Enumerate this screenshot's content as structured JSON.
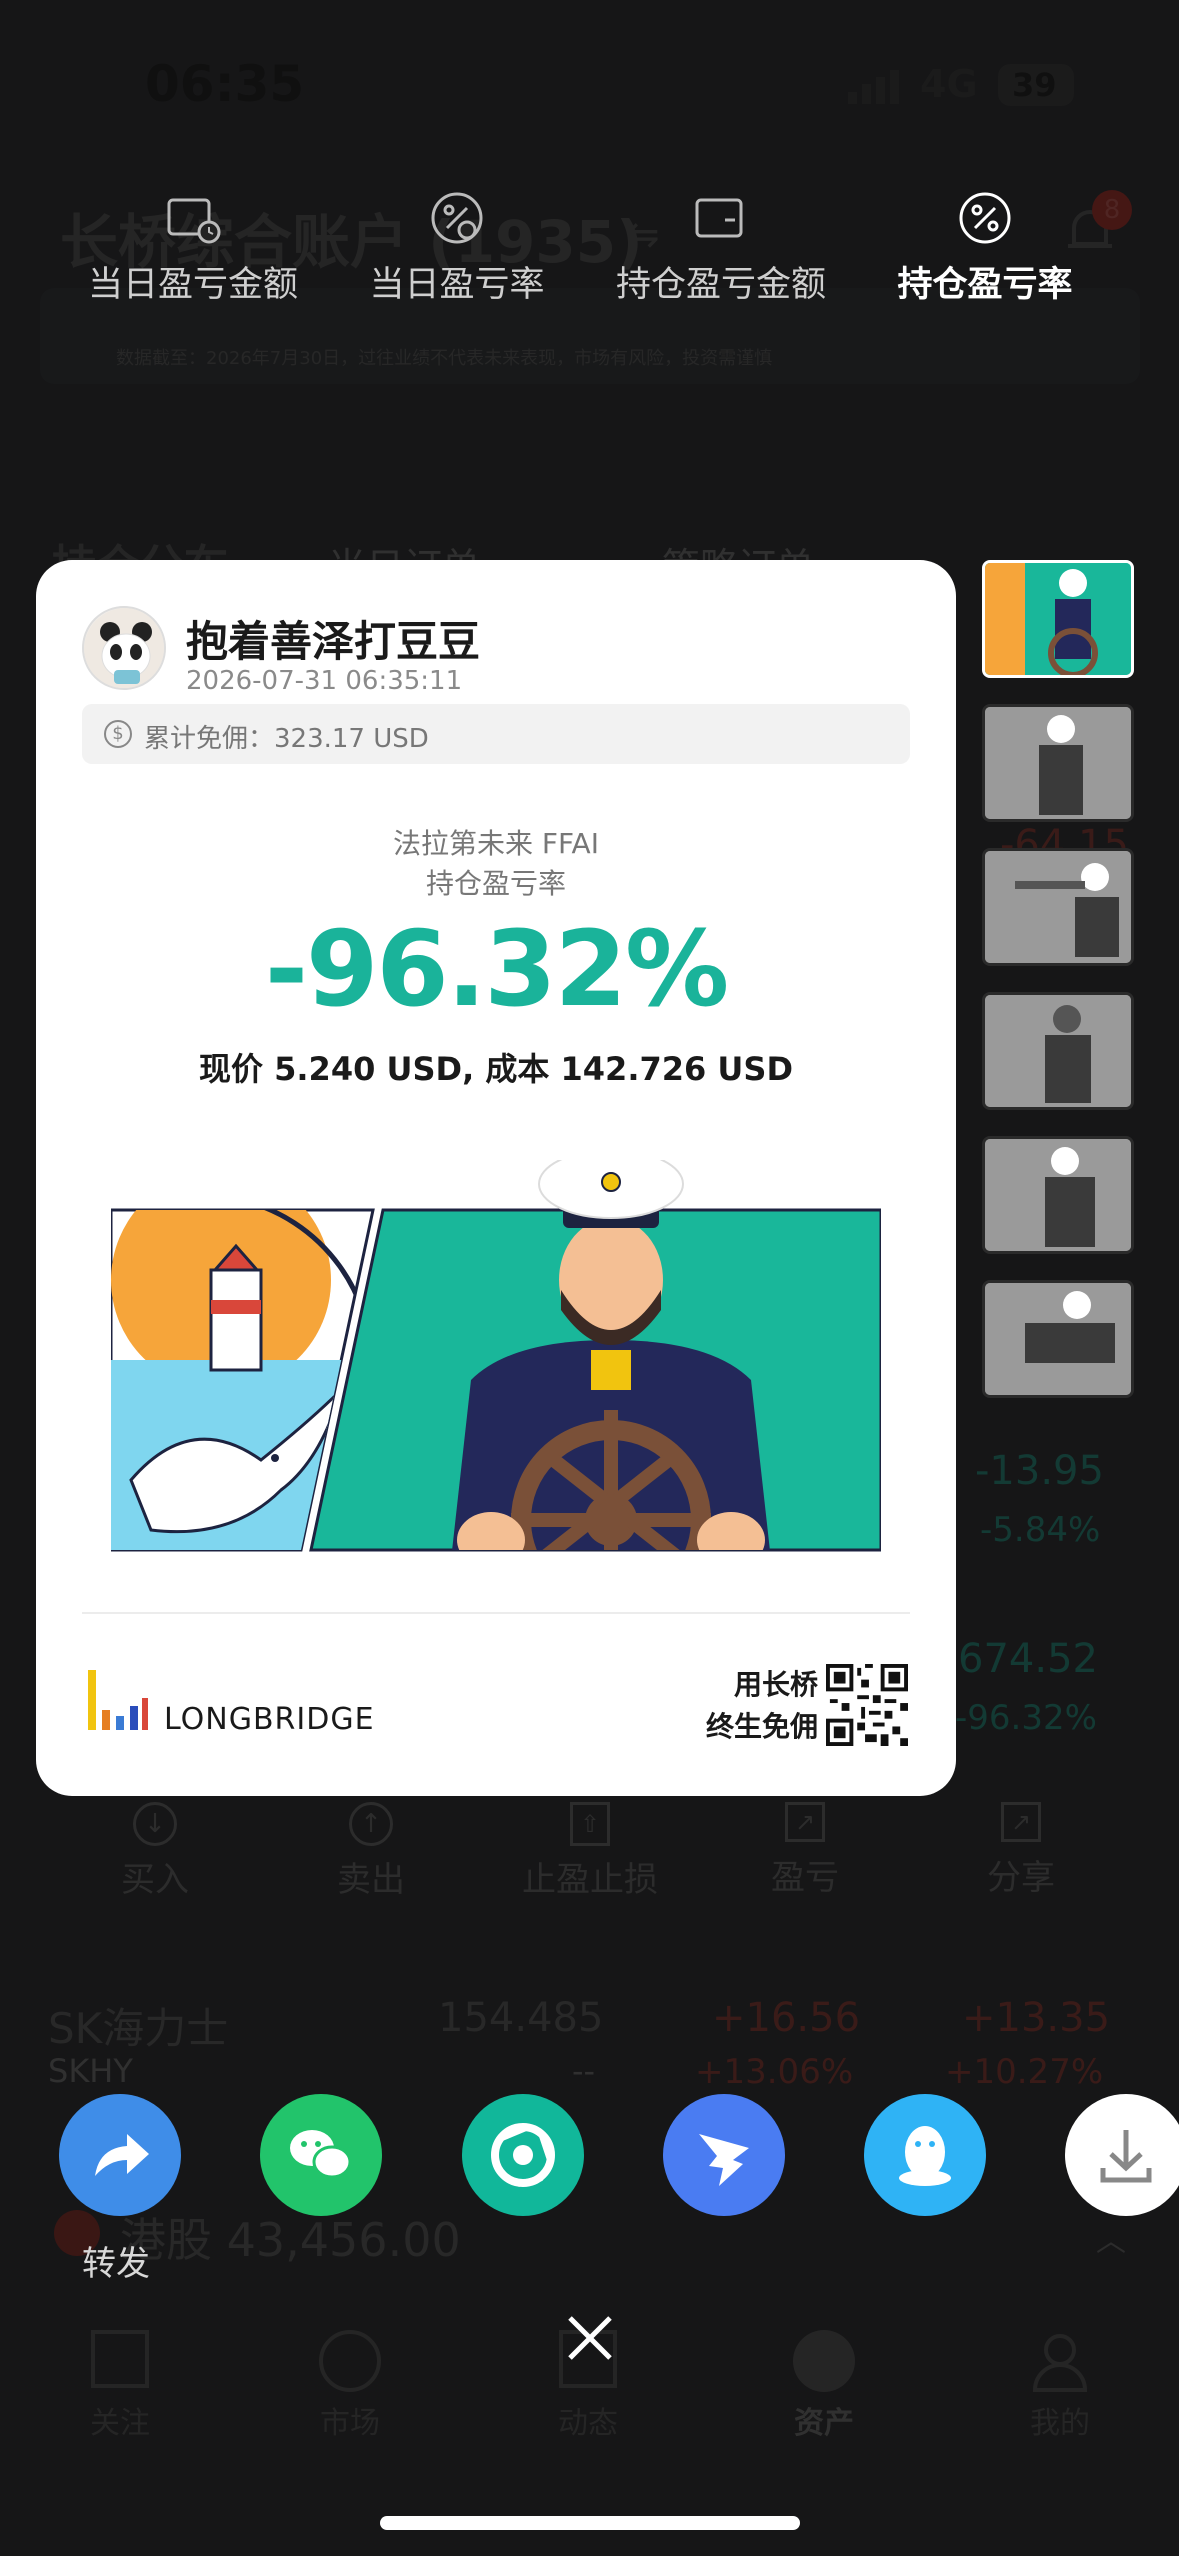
{
  "status_bar": {
    "time": "06:35",
    "network": "4G",
    "battery": "39"
  },
  "background": {
    "account_title": "长桥综合账户 (1935)",
    "banner_notice": "数据截至：2026年7月30日，过往业绩不代表未来表现，市场有风险，投资需谨慎",
    "section_tabs": [
      "持仓分布",
      "当日订单",
      "策略订单"
    ],
    "right_values": [
      "-64.15",
      "-13.95",
      "-5.84%",
      "674.52",
      "-96.32%"
    ],
    "action_bar": [
      "买入",
      "卖出",
      "止盈止损",
      "盈亏",
      "分享"
    ],
    "row_sk": {
      "name": "SK海力士",
      "ticker": "SKHY",
      "price": "154.485",
      "dash": "--",
      "change": "+16.56",
      "change_pct": "+13.06%",
      "pnl": "+13.35",
      "pnl_pct": "+10.27%"
    },
    "hk_section": "港股 43,456.00",
    "bottom_nav": [
      "关注",
      "市场",
      "动态",
      "资产",
      "我的"
    ],
    "notification_count": "8"
  },
  "metric_tabs": [
    {
      "label": "当日盈亏金额",
      "icon": "wallet-clock-icon",
      "active": false
    },
    {
      "label": "当日盈亏率",
      "icon": "percent-clock-icon",
      "active": false
    },
    {
      "label": "持仓盈亏金额",
      "icon": "wallet-icon",
      "active": false
    },
    {
      "label": "持仓盈亏率",
      "icon": "percent-icon",
      "active": true
    }
  ],
  "card": {
    "username": "抱着善泽打豆豆",
    "timestamp": "2026-07-31 06:35:11",
    "fee_label": "累计免佣：323.17 USD",
    "stock": "法拉第未来 FFAI",
    "metric": "持仓盈亏率",
    "value": "-96.32%",
    "value_color": "#1ab39a",
    "price_line": "现价 5.240 USD,  成本 142.726 USD",
    "brand": "LONGBRIDGE",
    "promo_line1": "用长桥",
    "promo_line2": "终生免佣"
  },
  "share": {
    "buttons": [
      {
        "name": "forward",
        "color": "#3f8de8",
        "icon": "forward-arrow-icon"
      },
      {
        "name": "wechat",
        "color": "#22c46b",
        "icon": "wechat-icon"
      },
      {
        "name": "moments",
        "color": "#11b79a",
        "icon": "moments-aperture-icon"
      },
      {
        "name": "dingtalk",
        "color": "#4a7cf2",
        "icon": "dingtalk-icon"
      },
      {
        "name": "qq",
        "color": "#2fb3f5",
        "icon": "qq-penguin-icon"
      },
      {
        "name": "save",
        "color": "#ffffff",
        "icon": "download-icon"
      }
    ],
    "first_label": "转发"
  }
}
